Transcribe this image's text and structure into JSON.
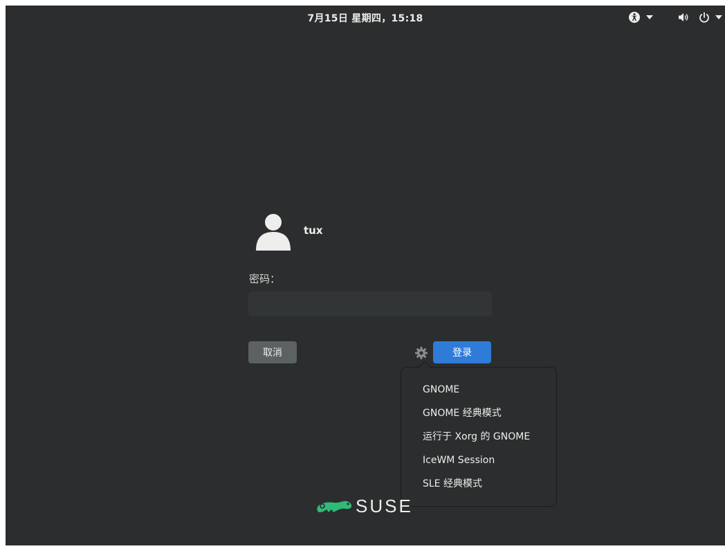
{
  "topbar": {
    "clock": "7月15日 星期四，15:18",
    "icons": [
      "accessibility-icon",
      "caret-down-icon",
      "volume-icon",
      "power-icon",
      "caret-down-icon"
    ]
  },
  "login": {
    "username": "tux",
    "avatar_icon": "user-avatar-icon",
    "password_label": "密码：",
    "password_value": "",
    "cancel_label": "取消",
    "login_label": "登录",
    "session_icon": "gear-icon"
  },
  "session_menu": {
    "items": [
      "GNOME",
      "GNOME 经典模式",
      "运行于 Xorg 的 GNOME",
      "IceWM Session",
      "SLE 经典模式"
    ]
  },
  "branding": {
    "logo_text": "SUSE",
    "logo_color": "#30ba78"
  },
  "colors": {
    "background": "#2b2d2e",
    "accent": "#2e7bd8",
    "cancel_button": "#5c6164",
    "text": "#eeeeec"
  }
}
